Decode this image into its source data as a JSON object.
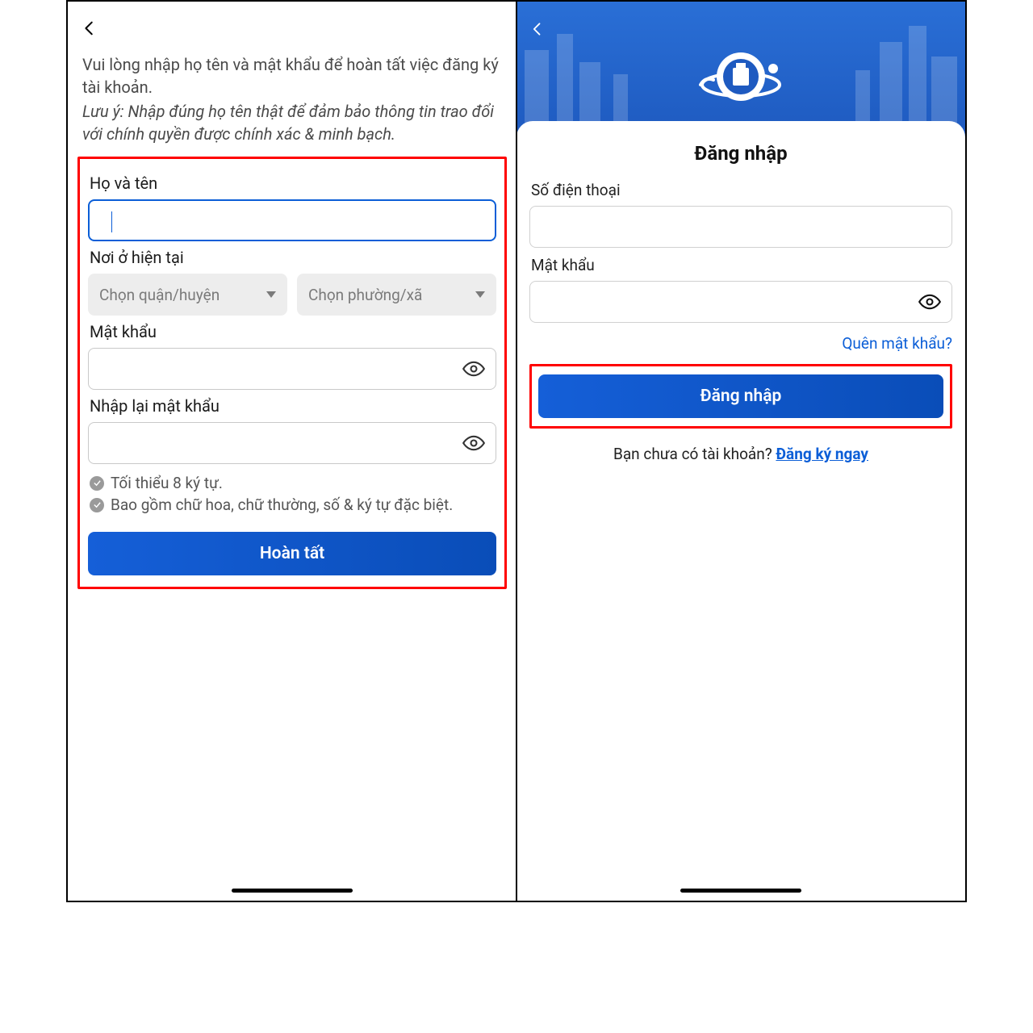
{
  "left": {
    "intro_line": "Vui lòng nhập họ tên và mật khẩu để hoàn tất việc đăng ký tài khoản.",
    "note_line": "Lưu ý: Nhập đúng họ tên thật để đảm bảo thông tin trao đổi với chính quyền được chính xác & minh bạch.",
    "fullname_label": "Họ và tên",
    "address_label": "Nơi ở hiện tại",
    "district_placeholder": "Chọn quận/huyện",
    "ward_placeholder": "Chọn phường/xã",
    "password_label": "Mật khẩu",
    "password_confirm_label": "Nhập lại mật khẩu",
    "rule1": "Tối thiểu 8 ký tự.",
    "rule2": "Bao gồm chữ hoa, chữ thường, số & ký tự đặc biệt.",
    "submit_label": "Hoàn tất"
  },
  "right": {
    "title": "Đăng nhập",
    "phone_label": "Số điện thoại",
    "password_label": "Mật khẩu",
    "forgot_label": "Quên mật khẩu?",
    "login_label": "Đăng nhập",
    "signup_prompt": "Bạn chưa có tài khoản? ",
    "signup_link": "Đăng ký ngay"
  }
}
